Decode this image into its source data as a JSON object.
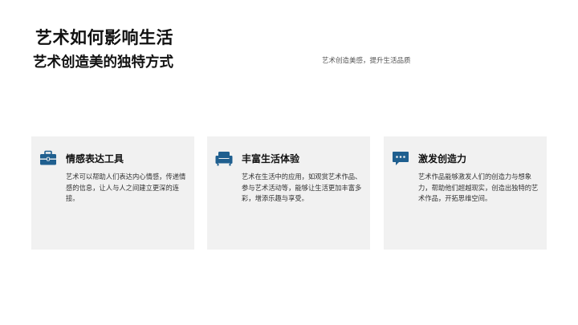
{
  "slide": {
    "title": "艺术如何影响生活",
    "subtitle": "艺术创造美的独特方式",
    "tagline": "艺术创造美感，提升生活品质"
  },
  "cards": [
    {
      "icon": "briefcase-icon",
      "title": "情感表达工具",
      "body": "艺术可以帮助人们表达内心情感，传递情感的信息，让人与人之间建立更深的连接。"
    },
    {
      "icon": "sofa-icon",
      "title": "丰富生活体验",
      "body": "艺术在生活中的应用，如观赏艺术作品、参与艺术活动等，能够让生活更加丰富多彩，增添乐趣与享受。"
    },
    {
      "icon": "chat-bubble-icon",
      "title": "激发创造力",
      "body": "艺术作品能够激发人们的创造力与想象力，帮助他们超越现实，创造出独特的艺术作品，开拓思维空间。"
    }
  ],
  "colors": {
    "accent": "#1f5f8f",
    "card_background": "#f1f1f1",
    "title_text": "#111111"
  }
}
